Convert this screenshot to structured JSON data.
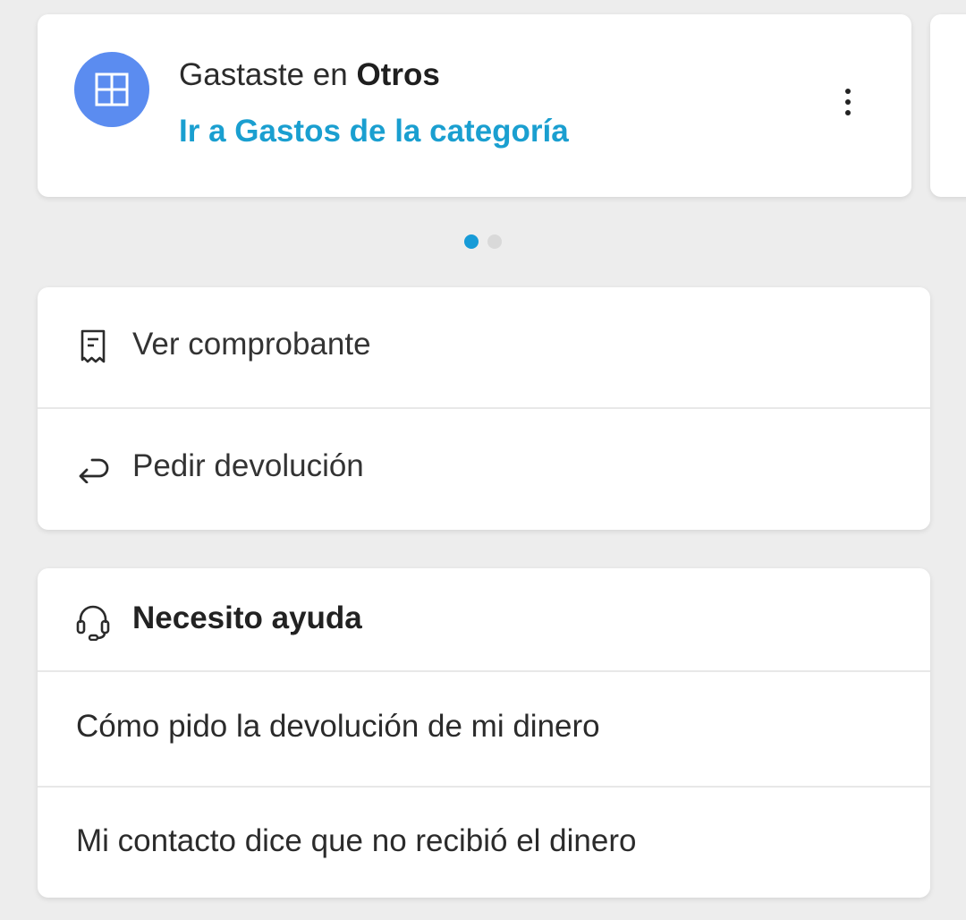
{
  "carousel": {
    "card": {
      "icon": "category-grid-icon",
      "icon_color": "#5b8cf0",
      "spent_prefix": "Gastaste en ",
      "category_name": "Otros",
      "category_link": "Ir a Gastos de la categoría",
      "link_color": "#1a9fd0",
      "menu_icon": "more-vertical-icon"
    },
    "page_count": 2,
    "active_page": 1,
    "active_dot_color": "#179bd7"
  },
  "actions": {
    "items": [
      {
        "icon": "receipt-icon",
        "label": "Ver comprobante"
      },
      {
        "icon": "return-arrow-icon",
        "label": "Pedir devolución"
      }
    ]
  },
  "help": {
    "icon": "headset-icon",
    "title": "Necesito ayuda",
    "items": [
      "Cómo pido la devolución de mi dinero",
      "Mi contacto dice que no recibió el dinero"
    ]
  }
}
